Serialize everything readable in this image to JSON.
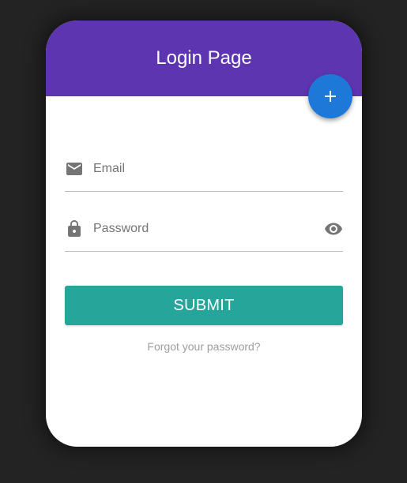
{
  "header": {
    "title": "Login Page"
  },
  "fab": {
    "icon": "plus-icon",
    "color": "#1e78d8"
  },
  "form": {
    "email": {
      "icon": "email-icon",
      "placeholder": "Email",
      "value": ""
    },
    "password": {
      "icon": "lock-icon",
      "placeholder": "Password",
      "value": "",
      "toggle_icon": "eye-icon"
    },
    "submit_label": "SUBMIT",
    "forgot_label": "Forgot your password?"
  },
  "colors": {
    "header": "#5e35b1",
    "submit": "#26a69a",
    "background": "#232323"
  }
}
